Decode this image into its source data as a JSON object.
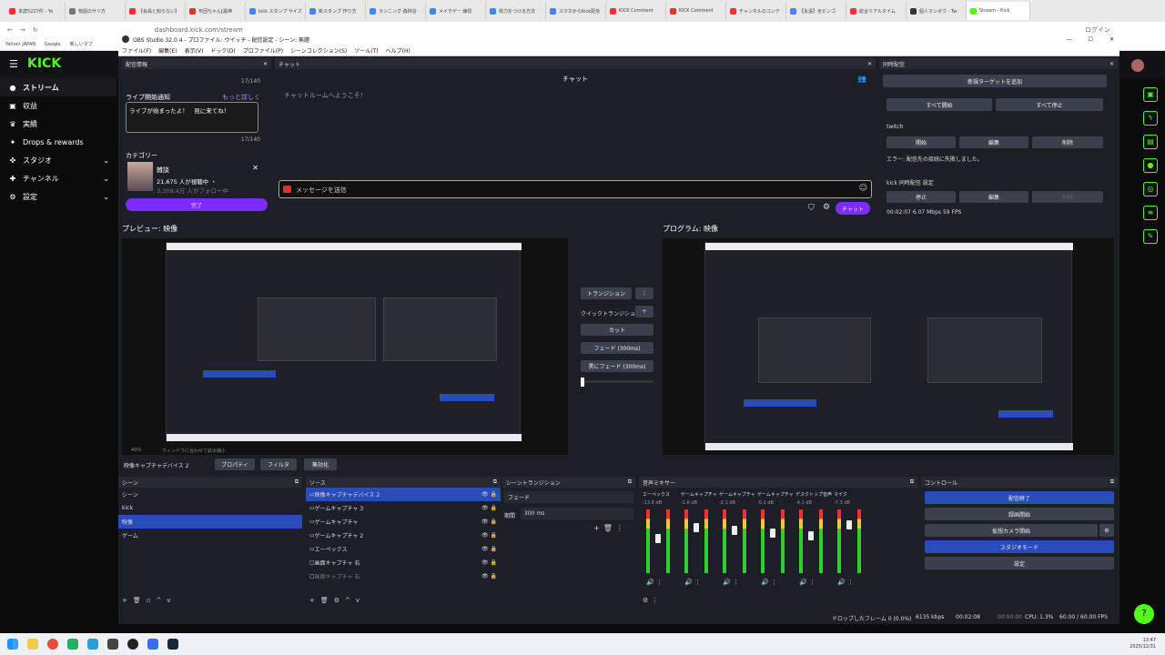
{
  "browser": {
    "tabs": [
      "未読5227件 - Yo",
      "物語のサリ方",
      "【会員と知らない】",
      "布団ちゃん[最神",
      "kick スタンプ サイズ",
      "新スタンプ 作り方",
      "ランニング 森林浴",
      "メイクゲー 練習",
      "体力をつける方法",
      "スマホからKick配信",
      "KICK Comment",
      "KICK Comment",
      "チャンネルのコンテ",
      "【永遠】全ビンゴ",
      "総合リアルタイム",
      "個人マンボウ - Tw",
      "Stream - Kick"
    ],
    "active_tab": "Stream - Kick",
    "url": "dashboard.kick.com/stream",
    "login": "ログイン",
    "bookmarks": [
      "Yahoo! JAPAN",
      "Google",
      "新しいタブ"
    ]
  },
  "kick": {
    "logo": "KICK",
    "nav": [
      {
        "label": "ストリーム",
        "icon": "dot-icon"
      },
      {
        "label": "収益",
        "icon": "wallet-icon"
      },
      {
        "label": "実績",
        "icon": "trophy-icon"
      },
      {
        "label": "Drops & rewards",
        "icon": "gift-icon"
      },
      {
        "label": "スタジオ",
        "icon": "studio-icon"
      },
      {
        "label": "チャンネル",
        "icon": "channel-icon"
      },
      {
        "label": "設定",
        "icon": "gear-icon"
      }
    ]
  },
  "obs": {
    "title": "OBS Studio 32.0.4 - プロファイル: ウイッチ - 配信設定 - シーン: 無題",
    "menu": [
      "ファイル(F)",
      "編集(E)",
      "表示(V)",
      "ドック(D)",
      "プロファイル(P)",
      "シーンコレクション(S)",
      "ツール(T)",
      "ヘルプ(H)"
    ],
    "stream_info": {
      "header": "配信情報",
      "count1": "17/140",
      "notify_label": "ライブ開始通知",
      "more": "もっと詳しく",
      "notify_text": "ライブが始まったよ！　見に来てね！",
      "count2": "17/140",
      "category_label": "カテゴリー",
      "category": "雑談",
      "viewers": "21,675 人が視聴中 ・",
      "followers": "3,309.4万 人がフォロー中",
      "done": "完了"
    },
    "chat": {
      "header": "チャット",
      "title": "チャット",
      "welcome": "チャットルームへようこそ！",
      "placeholder": "メッセージを送信",
      "send": "チャット"
    },
    "multi": {
      "header": "同時配信",
      "add": "新規ターゲットを追加",
      "start_all": "すべて開始",
      "stop_all": "すべて停止",
      "twitch": "twitch",
      "start": "開始",
      "edit": "編集",
      "delete": "削除",
      "error": "エラー: 配信先の接続に失敗しました。",
      "kick_row": "kick 同時配信 設定",
      "stop": "停止",
      "edit2": "編集",
      "delete2": "削除",
      "stats": "00:02:07  6.07 Mbps  59 FPS"
    },
    "preview_label": "プレビュー: 映像",
    "program_label": "プログラム: 映像",
    "zoom": "40%",
    "fit": "ウィンドウに合わせて拡大縮小",
    "transition": {
      "label": "トランジション",
      "quick": "クイックトランジション",
      "cut": "カット",
      "fade": "フェード (300ms)",
      "black": "黒にフェード (300ms)"
    },
    "source_bar": {
      "name": "映像キャプチャデバイス 2",
      "props": "プロパティ",
      "filters": "フィルタ",
      "disable": "無効化"
    },
    "scenes": {
      "header": "シーン",
      "items": [
        "シーン",
        "kick",
        "映像",
        "ゲーム"
      ],
      "selected": 2
    },
    "sources": {
      "header": "ソース",
      "items": [
        "映像キャプチャデバイス 2",
        "ゲームキャプチャ 3",
        "ゲームキャプチャ",
        "ゲームキャプチャ 2",
        "エーペックス",
        "画面キャプチャ 右",
        "画面キャプチャ 右"
      ]
    },
    "scene_trans": {
      "header": "シーントランジション",
      "type": "フェード",
      "duration_label": "期間",
      "duration": "300 ms"
    },
    "mixer": {
      "header": "音声ミキサー",
      "channels": [
        {
          "name": "エーペックス",
          "db": "-13.6 dB",
          "level": 0.55
        },
        {
          "name": "ゲームキャプチャ",
          "db": "-1.6 dB",
          "level": 0.75
        },
        {
          "name": "ゲームキャプチャ 2",
          "db": "-2.1 dB",
          "level": 0.7
        },
        {
          "name": "ゲームキャプチャ 3",
          "db": "-5.1 dB",
          "level": 0.65
        },
        {
          "name": "デスクトップ音声",
          "db": "-4.1 dB",
          "level": 0.6
        },
        {
          "name": "マイク",
          "db": "-7.3 dB",
          "level": 0.8
        }
      ]
    },
    "controls": {
      "header": "コントロール",
      "items": [
        "配信終了",
        "録画開始",
        "仮想カメラ開始",
        "スタジオモード",
        "設定"
      ]
    },
    "status": {
      "dropped": "ドロップしたフレーム 0 (0.0%)",
      "kbps": "6135 kbps",
      "time1": "00:02:08",
      "time2": "00:00:00",
      "cpu": "CPU: 1.3%",
      "fps": "60.00 / 60.00 FPS"
    }
  },
  "taskbar": {
    "time": "13:47",
    "date": "2025/12/31"
  },
  "colors": {
    "kick_green": "#53fc18",
    "obs_blue": "#284cb8",
    "kick_purple": "#7d2bff"
  }
}
